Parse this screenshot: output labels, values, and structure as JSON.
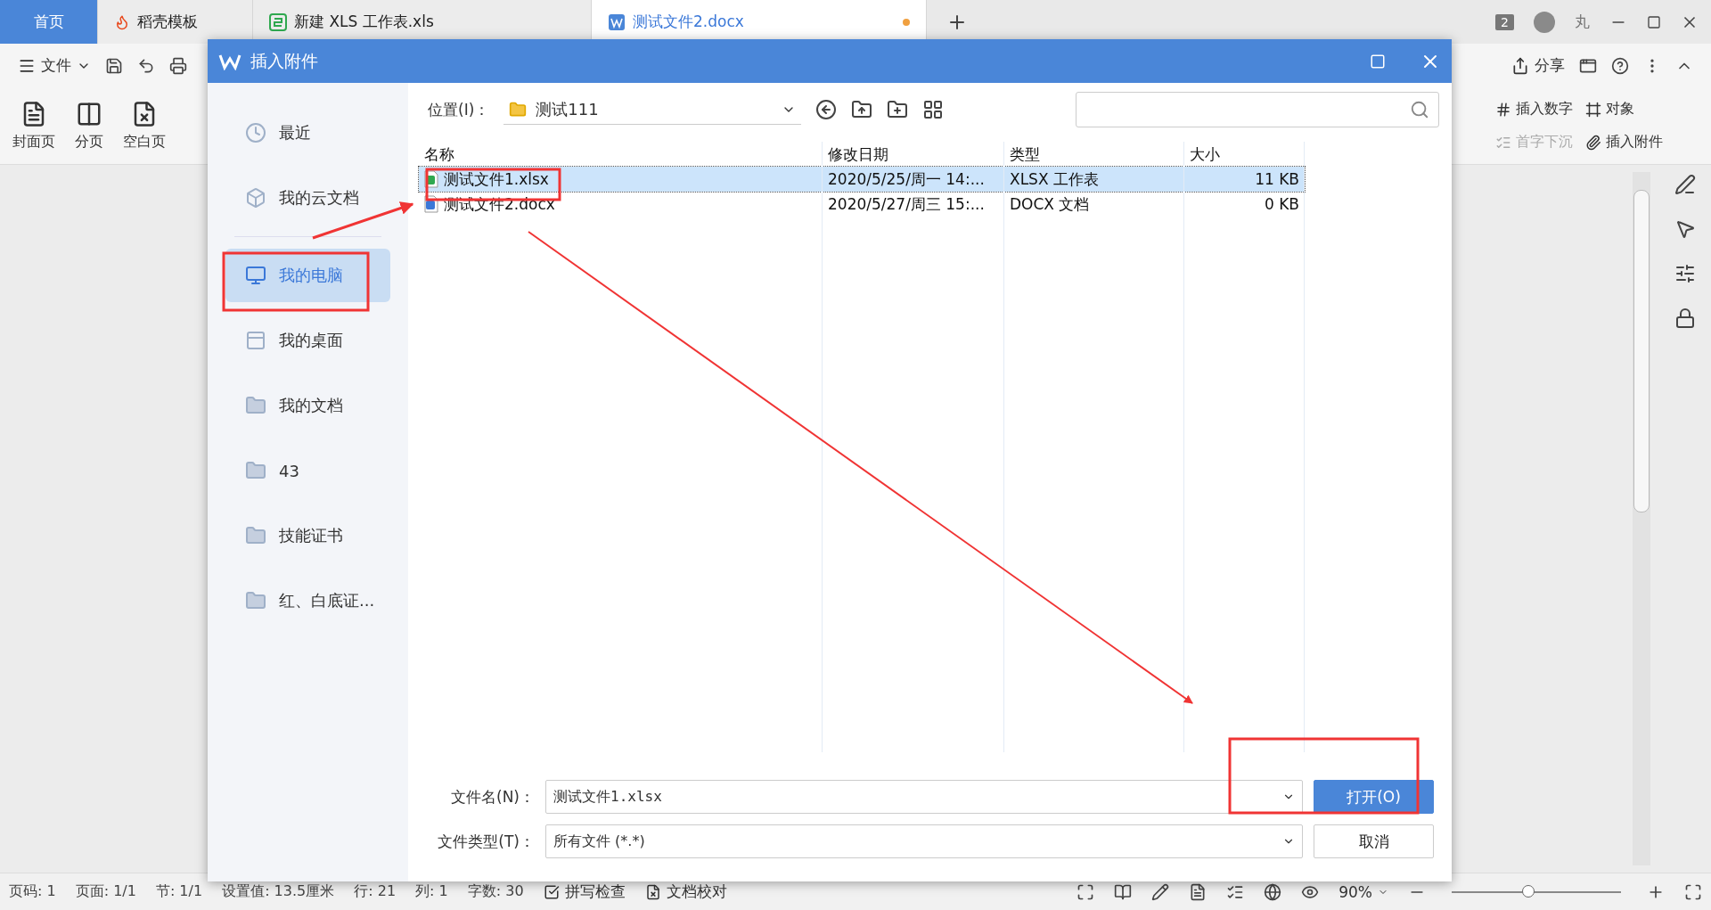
{
  "tabs": [
    {
      "label": "首页",
      "kind": "home",
      "selected": false,
      "modified": false
    },
    {
      "label": "稻壳模板",
      "kind": "docer",
      "selected": false,
      "modified": false
    },
    {
      "label": "新建 XLS 工作表.xls",
      "kind": "sheet",
      "selected": false,
      "modified": false
    },
    {
      "label": "测试文件2.docx",
      "kind": "writer",
      "selected": true,
      "modified": true
    }
  ],
  "window_badge": "2",
  "user_name": "丸",
  "file_menu": "文件",
  "share_button": "分享",
  "ribbon_left": [
    "封面页",
    "分页",
    "空白页"
  ],
  "ribbon_right": [
    {
      "label": "插入数字",
      "disabled": false
    },
    {
      "label": "对象",
      "disabled": false
    },
    {
      "label": "首字下沉",
      "disabled": true
    },
    {
      "label": "插入附件",
      "disabled": false
    }
  ],
  "dialog": {
    "title": "插入附件",
    "sidebar": [
      {
        "label": "最近",
        "kind": "recent",
        "selected": false
      },
      {
        "label": "我的云文档",
        "kind": "cloud",
        "selected": false
      },
      {
        "label": "我的电脑",
        "kind": "computer",
        "selected": true
      },
      {
        "label": "我的桌面",
        "kind": "desktop",
        "selected": false
      },
      {
        "label": "我的文档",
        "kind": "folder",
        "selected": false
      },
      {
        "label": "43",
        "kind": "folder",
        "selected": false
      },
      {
        "label": "技能证书",
        "kind": "folder",
        "selected": false
      },
      {
        "label": "红、白底证...",
        "kind": "folder",
        "selected": false
      }
    ],
    "location_label": "位置(I)：",
    "location": "测试111",
    "columns": [
      "名称",
      "修改日期",
      "类型",
      "大小"
    ],
    "rows": [
      {
        "kind": "xlsx",
        "name": "测试文件1.xlsx",
        "date": "2020/5/25/周一 14:...",
        "type": "XLSX 工作表",
        "size": "11 KB",
        "selected": true
      },
      {
        "kind": "docx",
        "name": "测试文件2.docx",
        "date": "2020/5/27/周三 15:...",
        "type": "DOCX 文档",
        "size": "0 KB",
        "selected": false
      }
    ],
    "filename_label": "文件名(N)：",
    "filename": "测试文件1.xlsx",
    "filetype_label": "文件类型(T)：",
    "filetype": "所有文件 (*.*)",
    "open_button": "打开(O)",
    "cancel_button": "取消"
  },
  "status_bar": {
    "items": [
      "页码: 1",
      "页面: 1/1",
      "节: 1/1",
      "设置值: 13.5厘米",
      "行: 21",
      "列: 1",
      "字数: 30"
    ],
    "spell_check": "拼写检查",
    "proofread": "文档校对",
    "zoom": "90%",
    "zoom_slider": {
      "level": 0.45
    }
  }
}
